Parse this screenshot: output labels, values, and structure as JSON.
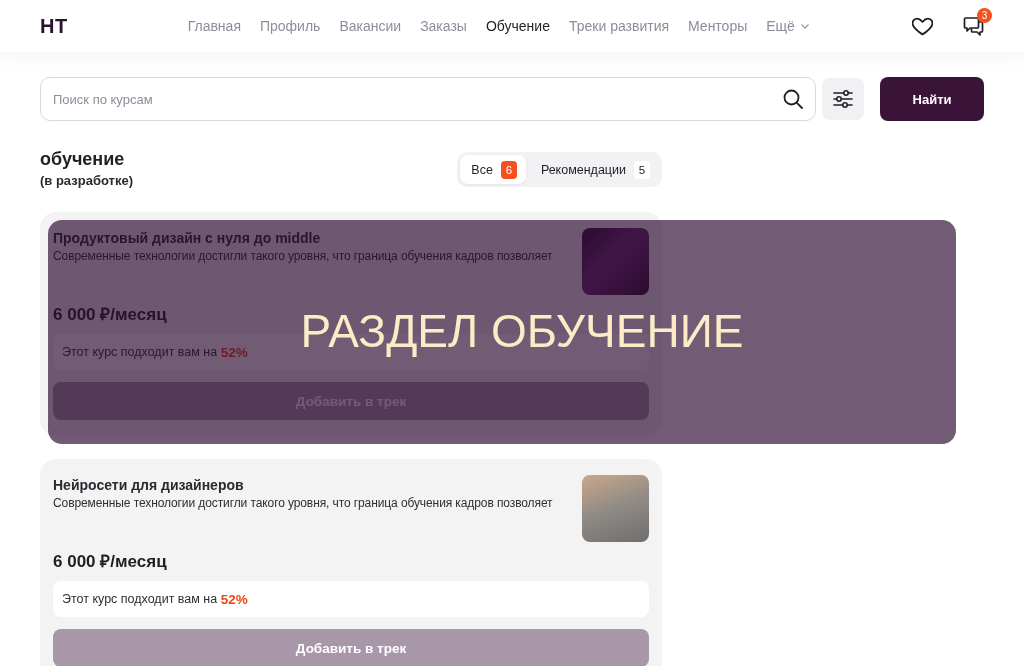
{
  "header": {
    "logo": "HT",
    "nav": [
      {
        "label": "Главная",
        "selected": false
      },
      {
        "label": "Профиль",
        "selected": false
      },
      {
        "label": "Вакансии",
        "selected": false
      },
      {
        "label": "Заказы",
        "selected": false
      },
      {
        "label": "Обучение",
        "selected": true
      },
      {
        "label": "Треки развития",
        "selected": false
      },
      {
        "label": "Менторы",
        "selected": false
      }
    ],
    "more": {
      "label": "Ещё"
    },
    "messages_badge": "3"
  },
  "search": {
    "placeholder": "Поиск по курсам",
    "button": "Найти"
  },
  "section": {
    "title": "обучение",
    "subtitle": "(в разработке)"
  },
  "tabs": [
    {
      "label": "Все",
      "count": "6",
      "selected": true
    },
    {
      "label": "Рекомендации",
      "count": "5",
      "selected": false
    }
  ],
  "courses": [
    {
      "title": "Продуктовый дизайн с нуля до middle",
      "description": "Современные технологии достигли такого уровня, что граница обучения кадров позволяет",
      "price": "6 000 ₽/месяц",
      "match": "Этот курс подходит вам на **52%**",
      "button": {
        "label": "Добавить в трек",
        "disabled": true
      }
    },
    {
      "title": "Нейросети для дизайнеров",
      "description": "Современные технологии достигли такого уровня, что граница обучения кадров позволяет",
      "price": "6 000 ₽/месяц",
      "match": "Этот курс подходит вам на **52%**",
      "button": {
        "label": "Добавить в трек",
        "disabled": true
      }
    }
  ],
  "banner": {
    "text": "РАЗДЕЛ ОБУЧЕНИЕ"
  }
}
